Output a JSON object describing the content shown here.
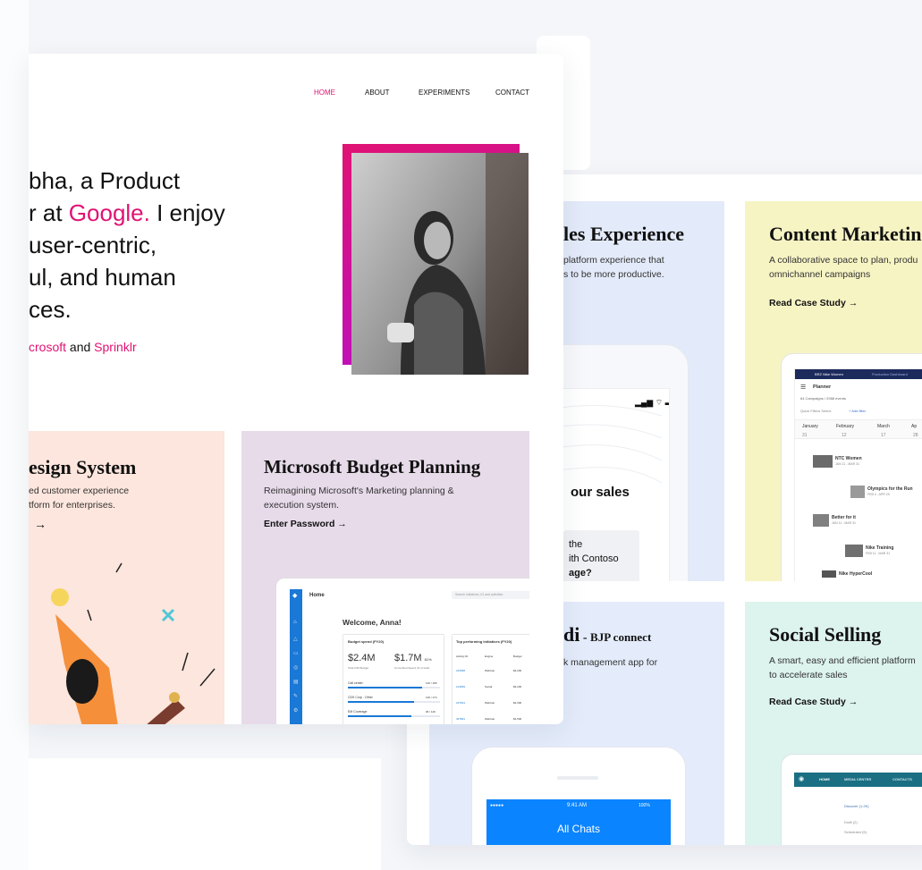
{
  "nav": {
    "home": "HOME",
    "about": "ABOUT",
    "experiments": "EXPERIMENTS",
    "contact": "CONTACT"
  },
  "hero": {
    "line1": "bha, a Product",
    "line2a": "r at ",
    "line2b": "Google.",
    "line2c": " I enjoy",
    "line3": " user-centric,",
    "line4": "ul, and human",
    "line5": "ces.",
    "sub_a": "crosoft",
    "sub_b": " and ",
    "sub_c": "Sprinklr"
  },
  "cards": {
    "design": {
      "title": "esign System",
      "desc1": "ed customer experience",
      "desc2": "tform for enterprises.",
      "arrow": "→"
    },
    "budget": {
      "title": "Microsoft Budget Planning",
      "desc1": "Reimagining Microsoft's Marketing planning &",
      "desc2": "execution system.",
      "link": "Enter Password",
      "arrow": "→"
    },
    "sales": {
      "title": "les Experience",
      "desc1": " platform experience that",
      "desc2": "s to be more productive.",
      "screen_heading": "our sales",
      "screen_text1": "the",
      "screen_text2": "ith Contoso",
      "screen_text3": "age?"
    },
    "content": {
      "title": "Content Marketin",
      "desc1": "A collaborative space to plan, produ",
      "desc2": "omnichannel campaigns",
      "link": "Read Case Study",
      "arrow": "→"
    },
    "odi": {
      "title": "di",
      "dash": " - ",
      "sub": "BJP connect",
      "desc": "k management app for"
    },
    "social": {
      "title": "Social Selling",
      "desc1": "A smart, easy and efficient platform",
      "desc2": "to accelerate sales",
      "link": "Read Case Study",
      "arrow": "→"
    }
  },
  "budget_app": {
    "home": "Home",
    "search_placeholder": "Search initiatives, IO and activities",
    "welcome": "Welcome, Anna!",
    "spend_title": "Budget spend (FY20)",
    "amount1": "$2.4M",
    "amount1_label": "Total O20 Budget",
    "amount2": "$1.7M",
    "amount2_pct": "81%",
    "amount2_label": "Committed Spend (% of total)",
    "rows": [
      {
        "name": "Call center",
        "val": "146 / 180"
      },
      {
        "name": "CDS Corp - Other",
        "val": "125 / 174"
      },
      {
        "name": "EM Coverage",
        "val": "96 / 140"
      }
    ],
    "top_title": "Top performing Initiatives (FY20)",
    "cols": [
      "Activity ID",
      "Engine",
      "Budget"
    ],
    "table": [
      [
        "234568",
        "Webinar",
        "$4,200"
      ],
      [
        "124569",
        "Social",
        "$3,200"
      ],
      [
        "237814",
        "Webinar",
        "$2,300"
      ],
      [
        "457891",
        "Webinar",
        "$1,500"
      ]
    ]
  },
  "planner": {
    "brand": "BRZ Nike Women",
    "tab": "Production Dashboard",
    "title": "Planner",
    "count": "64 Campaigns / 2988 events",
    "filter_label": "Quick Filters",
    "filter_select": "Select",
    "add_filter": "+ Add filter",
    "months": [
      "January",
      "February",
      "March",
      "Ap"
    ],
    "week_labels": [
      "31",
      "12",
      "17",
      "28"
    ],
    "events": [
      {
        "name": "NTC Women",
        "date": "JAN 11 - MAR 31"
      },
      {
        "name": "Olympics for the Run",
        "date": "FEB 4 - APR 29"
      },
      {
        "name": "Better for it",
        "date": "JAN 11 - MAR 31"
      },
      {
        "name": "Nike Training",
        "date": "FEB 11 - MAR 31"
      },
      {
        "name": "Nike HyperCool",
        "date": ""
      }
    ]
  },
  "chat": {
    "time": "9:41 AM",
    "carrier": "●●●●●",
    "battery": "100%",
    "title": "All Chats"
  },
  "social_app": {
    "home": "HOME",
    "media": "MEDIA CENTER",
    "contacts": "CONTACTS",
    "discover": "Discover (1.2K)",
    "draft": "Draft (2)",
    "scheduled": "Scheduled (5)"
  },
  "colors": {
    "accent": "#e01273",
    "design_bg": "#fde6dd",
    "budget_bg": "#e7dbea",
    "sales_bg": "#e3eaf9",
    "content_bg": "#f7f4c4",
    "odi_bg": "#e4ecfb",
    "social_bg": "#ddf3ee",
    "chat_blue": "#0a84ff"
  }
}
